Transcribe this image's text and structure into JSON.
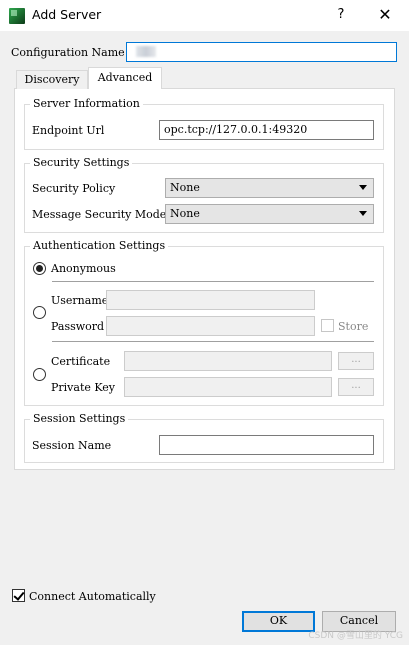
{
  "window": {
    "title": "Add Server",
    "help": "?",
    "close": "✕"
  },
  "config": {
    "label": "Configuration Name",
    "value": ""
  },
  "tabs": [
    {
      "label": "Discovery"
    },
    {
      "label": "Advanced"
    }
  ],
  "server_info": {
    "title": "Server Information",
    "endpoint_label": "Endpoint Url",
    "endpoint_value": "opc.tcp://127.0.0.1:49320"
  },
  "security": {
    "title": "Security Settings",
    "policy_label": "Security Policy",
    "policy_value": "None",
    "mode_label": "Message Security Mode",
    "mode_value": "None"
  },
  "auth": {
    "title": "Authentication Settings",
    "anonymous": "Anonymous",
    "username": "Username",
    "password": "Password",
    "store": "Store",
    "certificate": "Certificate",
    "private_key": "Private Key",
    "browse": "..."
  },
  "session": {
    "title": "Session Settings",
    "name_label": "Session Name",
    "name_value": ""
  },
  "connect_auto": "Connect Automatically",
  "buttons": {
    "ok": "OK",
    "cancel": "Cancel"
  },
  "watermark": "CSDN @雪山里的 YCG"
}
